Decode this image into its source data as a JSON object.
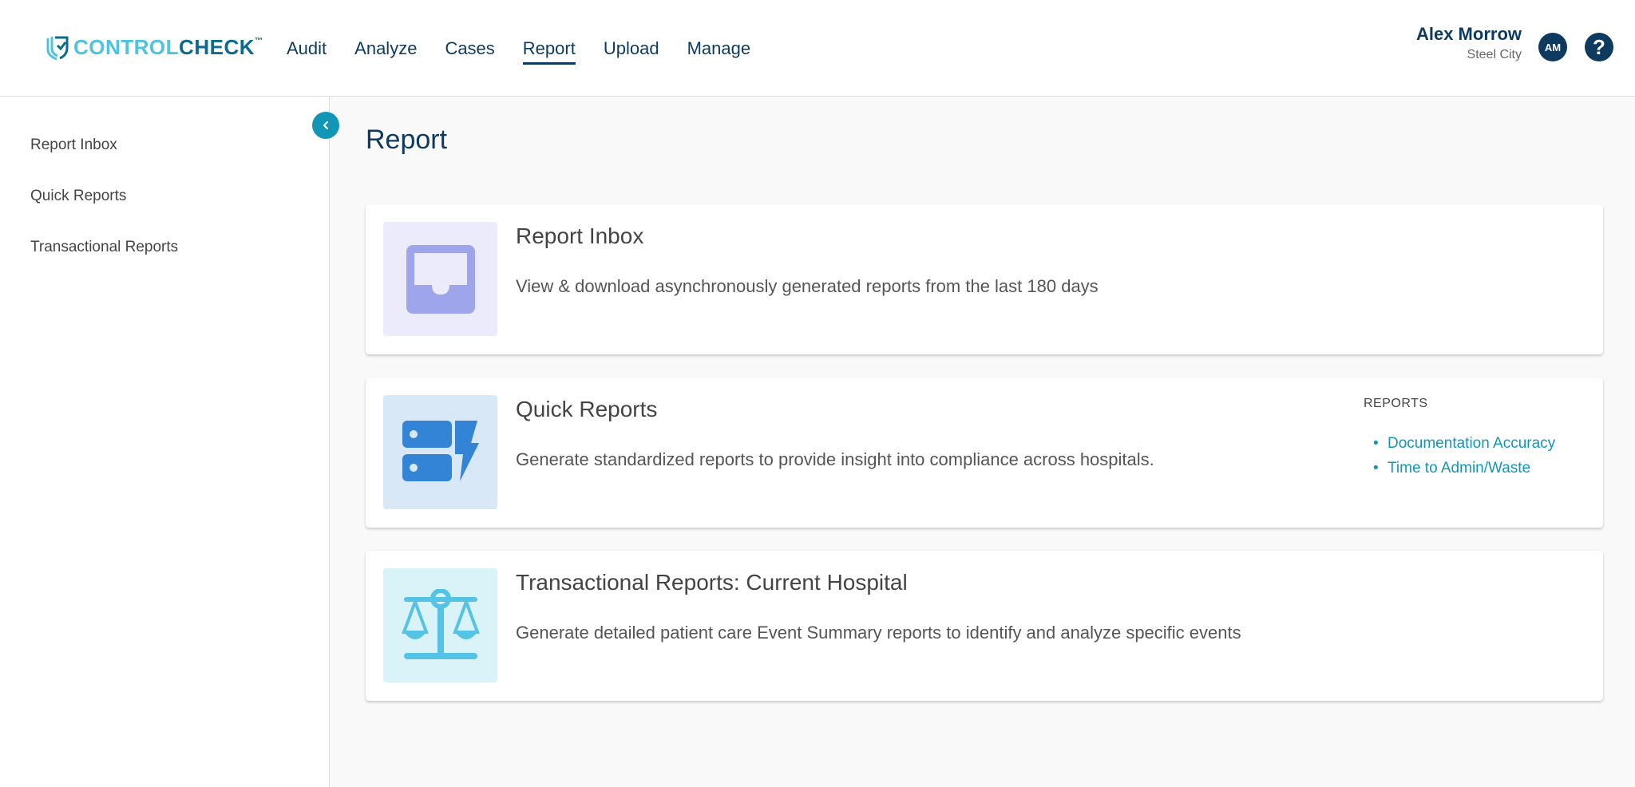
{
  "header": {
    "logo": {
      "part1": "CONTROL",
      "part2": "CHECK",
      "tm": "™"
    },
    "nav": [
      "Audit",
      "Analyze",
      "Cases",
      "Report",
      "Upload",
      "Manage"
    ],
    "active_nav": "Report",
    "user": {
      "name": "Alex Morrow",
      "location": "Steel City",
      "initials": "AM"
    },
    "help_label": "?"
  },
  "sidebar": {
    "items": [
      "Report Inbox",
      "Quick Reports",
      "Transactional Reports"
    ],
    "collapse_icon": "chevron-left-icon"
  },
  "page_title": "Report",
  "cards": [
    {
      "title": "Report Inbox",
      "description": "View & download asynchronously generated reports from the last 180 days",
      "icon": "inbox-icon",
      "icon_bg": "#ebebfb",
      "icon_color": "#9fa5ea"
    },
    {
      "title": "Quick Reports",
      "description": "Generate standardized reports to provide insight into compliance across hospitals.",
      "icon": "quick-report-icon",
      "icon_bg": "#d9e8f6",
      "icon_color": "#3384d6",
      "reports_label": "REPORTS",
      "reports": [
        "Documentation Accuracy",
        "Time to Admin/Waste"
      ]
    },
    {
      "title": "Transactional Reports: Current Hospital",
      "description": "Generate detailed patient care Event Summary reports to identify and analyze specific events",
      "icon": "scale-icon",
      "icon_bg": "#daf3f8",
      "icon_color": "#55c3e6"
    }
  ],
  "colors": {
    "brand_dark": "#0d3a5e",
    "accent": "#1296b8",
    "logo_light": "#4fc3df"
  }
}
